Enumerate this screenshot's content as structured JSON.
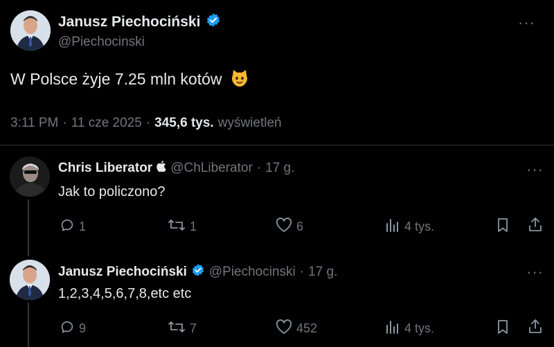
{
  "main_tweet": {
    "author_name": "Janusz Piechociński",
    "handle": "@Piechocinski",
    "text": "W Polsce żyje 7.25 mln kotów",
    "emoji": "😺",
    "time": "3:11 PM",
    "sep1": "·",
    "date": "11 cze 2025",
    "sep2": "·",
    "views_count": "345,6 tys.",
    "views_label": "wyświetleń",
    "more": "···"
  },
  "replies": [
    {
      "author_name": "Chris Liberator",
      "badge": "",
      "handle": "@ChLiberator",
      "sep": "·",
      "age": "17 g.",
      "text": "Jak to policzono?",
      "more": "···",
      "reply_count": "1",
      "retweet_count": "1",
      "like_count": "6",
      "views": "4 tys."
    },
    {
      "author_name": "Janusz Piechociński",
      "handle": "@Piechocinski",
      "sep": "·",
      "age": "17 g.",
      "text": "1,2,3,4,5,6,7,8,etc etc",
      "more": "···",
      "reply_count": "9",
      "retweet_count": "7",
      "like_count": "452",
      "views": "4 tys."
    }
  ],
  "colors": {
    "background": "#000000",
    "verified": "#1d9bf0",
    "muted": "#71767b",
    "text": "#e7e9ea"
  }
}
